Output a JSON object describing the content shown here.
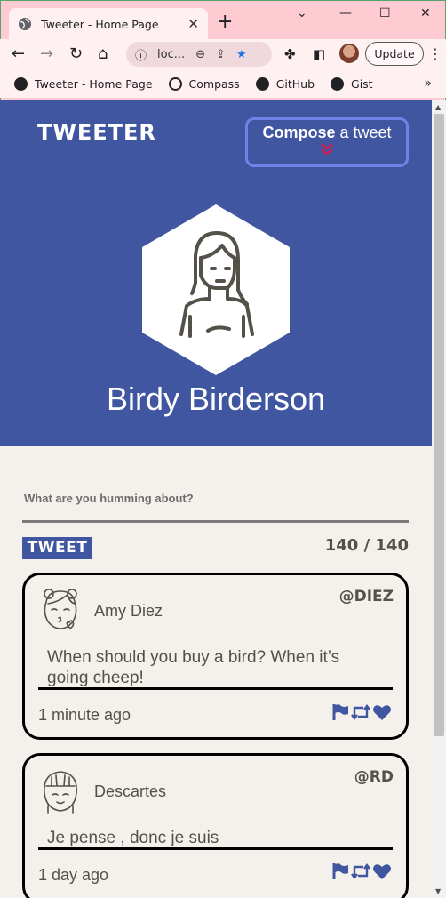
{
  "browser": {
    "tab_title": "Tweeter - Home Page",
    "tab_close": "✕",
    "new_tab": "+",
    "omnibox_text": "loc...",
    "update_label": "Update",
    "bookmarks": [
      {
        "label": "Tweeter - Home Page"
      },
      {
        "label": "Compass"
      },
      {
        "label": "GitHub"
      },
      {
        "label": "Gist"
      }
    ],
    "bookmarks_more": "»"
  },
  "header": {
    "brand": "TWEETER",
    "compose_bold": "Compose",
    "compose_rest": " a tweet",
    "compose_chevron": "⌄⌄",
    "username": "Birdy Birderson"
  },
  "composer": {
    "prompt": "What are you humming about?",
    "submit_label": "TWEET",
    "counter": "140 / 140"
  },
  "tweets": [
    {
      "name": "Amy Diez",
      "handle": "@DIEZ",
      "content": "When should you buy a bird? When it’s going cheep!",
      "time": "1 minute ago"
    },
    {
      "name": "Descartes",
      "handle": "@RD",
      "content": "Je pense , donc je suis",
      "time": "1 day ago"
    }
  ],
  "colors": {
    "header_bg": "#4056a1",
    "page_bg": "#f4f1ec",
    "compose_border": "#6d84e6",
    "chevron": "#d81b4f",
    "text_dark": "#545149"
  }
}
